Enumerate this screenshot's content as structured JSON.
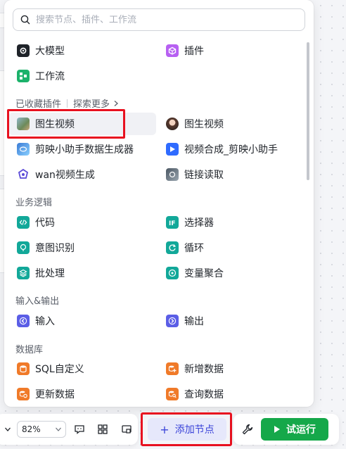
{
  "search": {
    "placeholder": "搜索节点、插件、工作流"
  },
  "top_items": [
    {
      "label": "大模型",
      "icon": "model-icon"
    },
    {
      "label": "插件",
      "icon": "plugin-cube-icon"
    },
    {
      "label": "工作流",
      "icon": "workflow-icon"
    }
  ],
  "plugins_section": {
    "title": "已收藏插件",
    "explore": "探索更多"
  },
  "plugins": [
    {
      "label": "图生视频",
      "icon": "image-to-video-landscape-icon"
    },
    {
      "label": "图生视频",
      "icon": "image-to-video-portrait-icon"
    },
    {
      "label": "剪映小助手数据生成器",
      "icon": "jianying-data-icon"
    },
    {
      "label": "视频合成_剪映小助手",
      "icon": "video-compose-icon"
    },
    {
      "label": "wan视频生成",
      "icon": "wan-video-icon"
    },
    {
      "label": "链接读取",
      "icon": "link-reader-icon"
    }
  ],
  "logic_section": {
    "title": "业务逻辑"
  },
  "logic": [
    {
      "label": "代码",
      "icon": "code-icon"
    },
    {
      "label": "选择器",
      "icon": "if-selector-icon"
    },
    {
      "label": "意图识别",
      "icon": "intent-icon"
    },
    {
      "label": "循环",
      "icon": "loop-icon"
    },
    {
      "label": "批处理",
      "icon": "batch-icon"
    },
    {
      "label": "变量聚合",
      "icon": "variable-aggregate-icon"
    }
  ],
  "io_section": {
    "title": "输入&输出"
  },
  "io": [
    {
      "label": "输入",
      "icon": "input-icon"
    },
    {
      "label": "输出",
      "icon": "output-icon"
    }
  ],
  "db_section": {
    "title": "数据库"
  },
  "db": [
    {
      "label": "SQL自定义",
      "icon": "sql-icon"
    },
    {
      "label": "新增数据",
      "icon": "db-add-icon"
    },
    {
      "label": "更新数据",
      "icon": "db-update-icon"
    },
    {
      "label": "查询数据",
      "icon": "db-query-icon"
    }
  ],
  "toolbar": {
    "zoom": "82%",
    "add_node": "添加节点",
    "run": "试运行"
  },
  "colors": {
    "logic_teal": "#12a899",
    "io_purple": "#5b5ee6",
    "db_orange": "#f07a29",
    "run_green": "#15a84a",
    "highlight_red": "#e8111f"
  }
}
